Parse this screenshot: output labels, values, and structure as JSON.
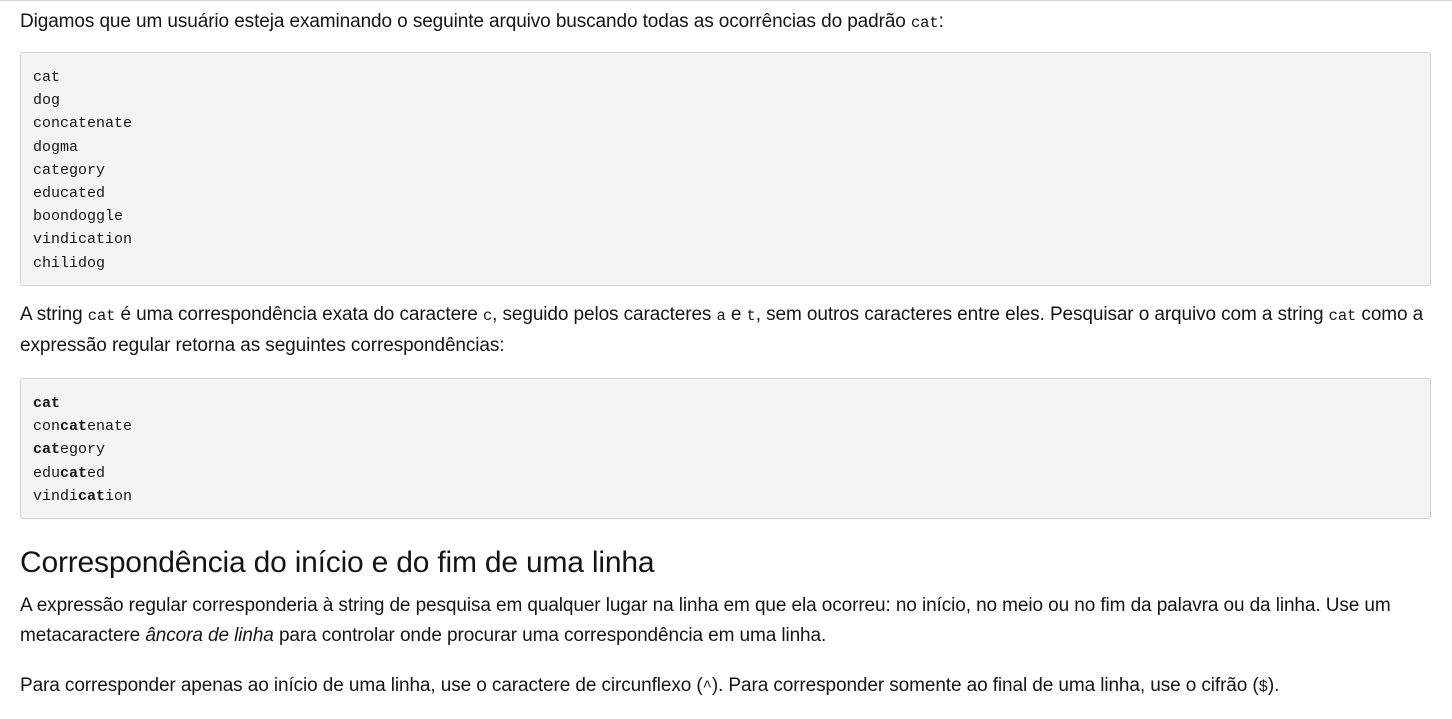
{
  "intro": {
    "text_before": "Digamos que um usuário esteja examinando o seguinte arquivo buscando todas as ocorrências do padrão ",
    "code": "cat",
    "text_after": ":"
  },
  "file_lines": [
    "cat",
    "dog",
    "concatenate",
    "dogma",
    "category",
    "educated",
    "boondoggle",
    "vindication",
    "chilidog"
  ],
  "para2": {
    "t1": "A string ",
    "c1": "cat",
    "t2": " é uma correspondência exata do caractere ",
    "c2": "c",
    "t3": ", seguido pelos caracteres ",
    "c3": "a",
    "t4": " e ",
    "c4": "t",
    "t5": ", sem outros caracteres entre eles. Pesquisar o arquivo com a string ",
    "c5": "cat",
    "t6": " como a expressão regular retorna as seguintes correspondências:"
  },
  "matches": [
    {
      "pre": "",
      "match": "cat",
      "post": ""
    },
    {
      "pre": "con",
      "match": "cat",
      "post": "enate"
    },
    {
      "pre": "",
      "match": "cat",
      "post": "egory"
    },
    {
      "pre": "edu",
      "match": "cat",
      "post": "ed"
    },
    {
      "pre": "vindi",
      "match": "cat",
      "post": "ion"
    }
  ],
  "heading": "Correspondência do início e do fim de uma linha",
  "para3": {
    "t1": "A expressão regular corresponderia à string de pesquisa em qualquer lugar na linha em que ela ocorreu: no início, no meio ou no fim da palavra ou da linha. Use um metacaractere ",
    "em": "âncora de linha",
    "t2": " para controlar onde procurar uma correspondência em uma linha."
  },
  "para4": {
    "t1": "Para corresponder apenas ao início de uma linha, use o caractere de circunflexo (",
    "c1": "^",
    "t2": "). Para corresponder somente ao final de uma linha, use o cifrão (",
    "c2": "$",
    "t3": ")."
  }
}
